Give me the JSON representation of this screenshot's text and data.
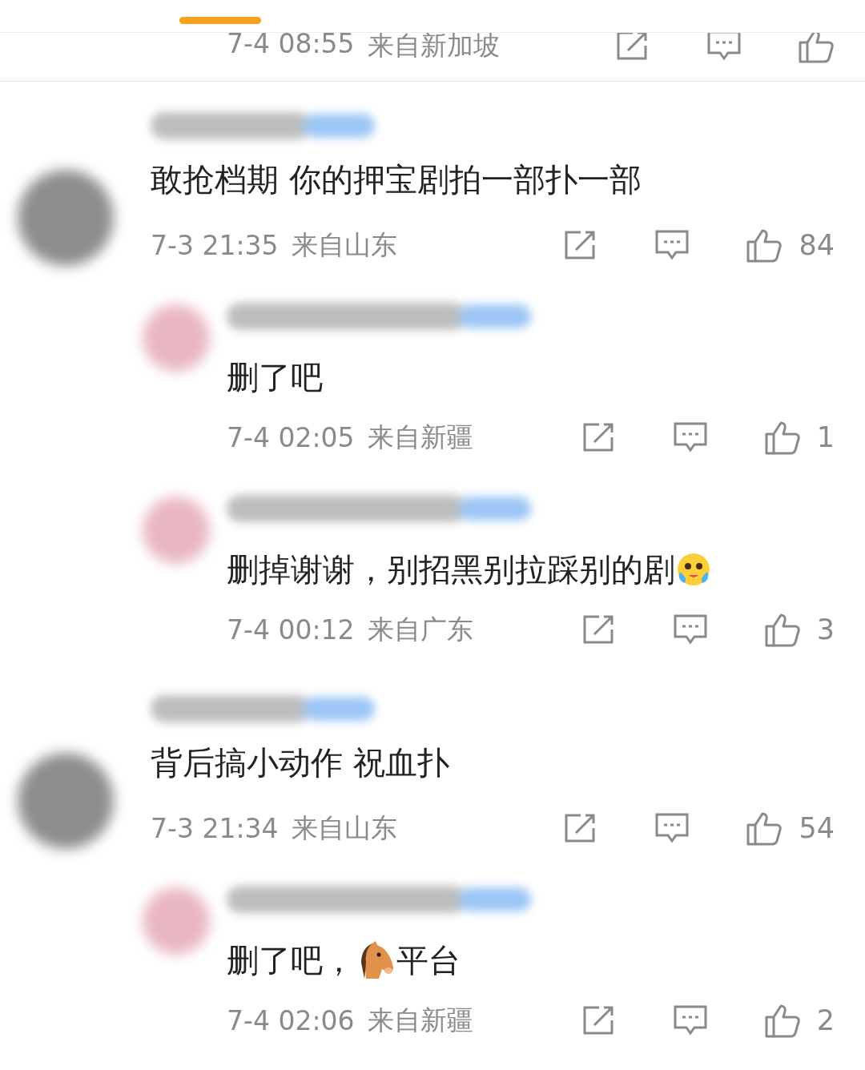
{
  "comments": [
    {
      "kind": "partial",
      "time": "7-4 08:55",
      "location": "来自新加坡"
    },
    {
      "kind": "top",
      "segments": [
        {
          "kind": "text",
          "text": "敢抢档期 你的押宝剧拍一部扑一部"
        }
      ],
      "time": "7-3 21:35",
      "location": "来自山东",
      "likes": "84"
    },
    {
      "kind": "reply",
      "segments": [
        {
          "kind": "text",
          "text": "删了吧"
        }
      ],
      "time": "7-4 02:05",
      "location": "来自新疆",
      "likes": "1"
    },
    {
      "kind": "reply",
      "segments": [
        {
          "kind": "text",
          "text": "删掉谢谢，别招黑别拉踩别的剧"
        },
        {
          "kind": "crying-emoji"
        }
      ],
      "time": "7-4 00:12",
      "location": "来自广东",
      "likes": "3"
    },
    {
      "kind": "top",
      "segments": [
        {
          "kind": "text",
          "text": "背后搞小动作 祝血扑"
        }
      ],
      "time": "7-3 21:34",
      "location": "来自山东",
      "likes": "54"
    },
    {
      "kind": "reply",
      "segments": [
        {
          "kind": "text",
          "text": "删了吧，"
        },
        {
          "kind": "horse-emoji"
        },
        {
          "kind": "text",
          "text": "平台"
        }
      ],
      "time": "7-4 02:06",
      "location": "来自新疆",
      "likes": "2"
    }
  ]
}
